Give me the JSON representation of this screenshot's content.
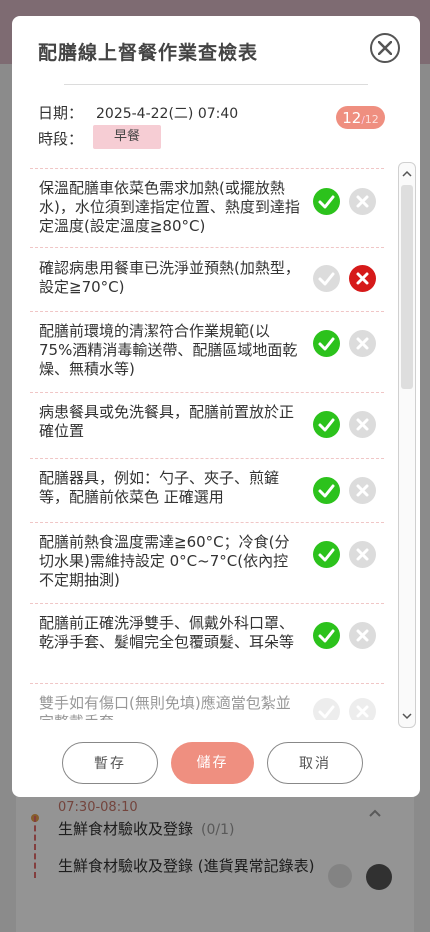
{
  "modal": {
    "title": "配膳線上督餐作業查檢表",
    "date_label": "日期：",
    "date_value": "2025-4-22(二) 07:40",
    "slot_label": "時段：",
    "slot_value": "早餐",
    "count_done": "12",
    "count_total": "12"
  },
  "items": [
    {
      "text": "保溫配膳車依菜色需求加熱(或擺放熱水)，水位須到達指定位置、熱度到達指定溫度(設定溫度≧80°C)",
      "status": "ok"
    },
    {
      "text": "確認病患用餐車已洗淨並預熱(加熱型，設定≧70°C)",
      "status": "ng"
    },
    {
      "text": "配膳前環境的清潔符合作業規範(以75%酒精消毒輸送帶、配膳區域地面乾燥、無積水等)",
      "status": "ok"
    },
    {
      "text": "病患餐具或免洗餐具，配膳前置放於正確位置",
      "status": "ok"
    },
    {
      "text": "配膳器具，例如：勺子、夾子、煎鏟等，配膳前依菜色 正確選用",
      "status": "ok"
    },
    {
      "text": "配膳前熱食溫度需達≧60°C；冷食(分切水果)需維持設定 0°C~7°C(依內控不定期抽測)",
      "status": "ok"
    },
    {
      "text": "配膳前正確洗淨雙手、佩戴外科口罩、乾淨手套、髮帽完全包覆頭髮、耳朵等",
      "status": "ok"
    },
    {
      "text": "雙手如有傷口(無則免填)應適當包紮並完整戴手套",
      "status": "none"
    }
  ],
  "buttons": {
    "temp_save": "暫存",
    "save": "儲存",
    "cancel": "取消"
  },
  "background": {
    "time": "07:30-08:10",
    "item1": "生鮮食材驗收及登錄",
    "item1_count": "(0/1)",
    "item2": "生鮮食材驗收及登錄 (進貨異常記錄表)"
  },
  "colors": {
    "accent": "#ef8f80",
    "ok": "#2cc21c",
    "ng": "#d61a1a",
    "badge": "#f6cdd4"
  }
}
